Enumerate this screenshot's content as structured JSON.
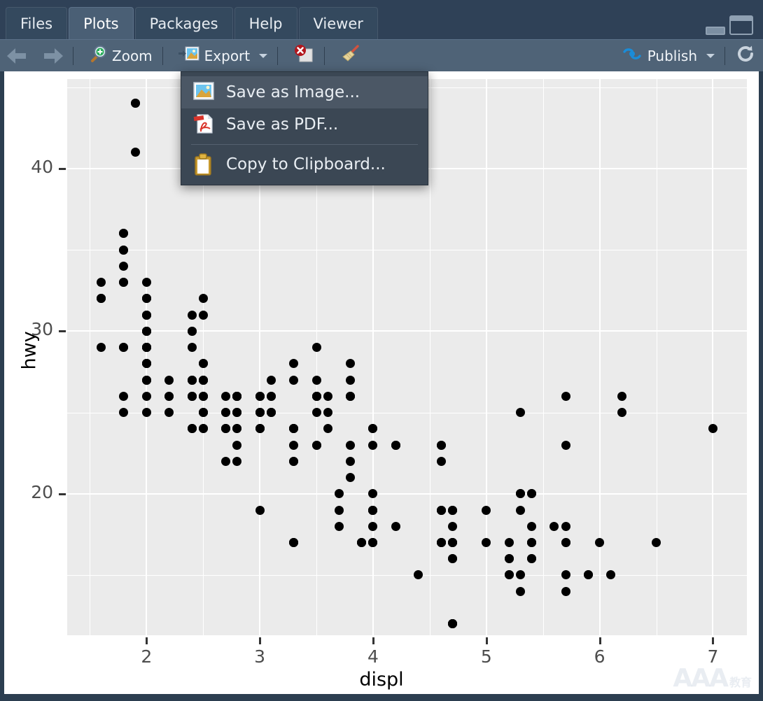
{
  "window": {
    "tabs": [
      {
        "label": "Files",
        "active": false
      },
      {
        "label": "Plots",
        "active": true
      },
      {
        "label": "Packages",
        "active": false
      },
      {
        "label": "Help",
        "active": false
      },
      {
        "label": "Viewer",
        "active": false
      }
    ],
    "controls": [
      {
        "name": "minimize-button",
        "label": "Minimize"
      },
      {
        "name": "maximize-button",
        "label": "Maximize"
      }
    ]
  },
  "toolbar": {
    "back_label": "Back",
    "forward_label": "Forward",
    "zoom_label": "Zoom",
    "export_label": "Export",
    "remove_plot_label": "Remove current plot",
    "clear_all_label": "Clear all plots",
    "publish_label": "Publish",
    "refresh_label": "Refresh current plot"
  },
  "export_menu": {
    "open": true,
    "items": [
      {
        "label": "Save as Image...",
        "icon": "image-icon",
        "selected": true
      },
      {
        "label": "Save as PDF...",
        "icon": "pdf-icon",
        "selected": false
      },
      {
        "label": "Copy to Clipboard...",
        "icon": "clipboard-icon",
        "selected": false
      }
    ]
  },
  "watermark": {
    "text": "AAA",
    "sub": "教育"
  },
  "colors": {
    "tabbar_bg": "#2f4157",
    "tab_active_bg": "#4a5f75",
    "toolbar_bg": "#4f6377",
    "menu_bg": "#3b4754",
    "menu_selected_bg": "#4b5765",
    "panel_bg": "#ebebeb",
    "gridline": "#ffffff",
    "point": "#000000",
    "publish_blue": "#1a8cd8",
    "plot_bg": "#ffffff"
  },
  "chart_data": {
    "type": "scatter",
    "title": "",
    "xlabel": "displ",
    "ylabel": "hwy",
    "xlim": [
      1.3,
      7.3
    ],
    "ylim": [
      11.3,
      45.5
    ],
    "xticks": [
      2,
      3,
      4,
      5,
      6,
      7
    ],
    "yticks": [
      20,
      30,
      40
    ],
    "x_minor_ticks": [
      1.5,
      2.5,
      3.5,
      4.5,
      5.5,
      6.5
    ],
    "y_minor_ticks": [
      15,
      25,
      35,
      45
    ],
    "grid": true,
    "legend": "none",
    "point_color": "#000000",
    "point_size": 13,
    "panel_background": "#ebebeb",
    "n_points": 234,
    "points": [
      [
        1.8,
        29
      ],
      [
        1.8,
        29
      ],
      [
        2.0,
        31
      ],
      [
        2.0,
        30
      ],
      [
        2.8,
        26
      ],
      [
        2.8,
        26
      ],
      [
        3.1,
        27
      ],
      [
        1.8,
        26
      ],
      [
        1.8,
        25
      ],
      [
        2.0,
        28
      ],
      [
        2.0,
        27
      ],
      [
        2.8,
        25
      ],
      [
        2.8,
        25
      ],
      [
        3.1,
        25
      ],
      [
        3.1,
        25
      ],
      [
        2.8,
        24
      ],
      [
        3.1,
        25
      ],
      [
        4.2,
        23
      ],
      [
        5.3,
        20
      ],
      [
        5.3,
        15
      ],
      [
        5.3,
        20
      ],
      [
        5.7,
        17
      ],
      [
        6.0,
        17
      ],
      [
        5.7,
        26
      ],
      [
        5.7,
        23
      ],
      [
        6.2,
        26
      ],
      [
        6.2,
        25
      ],
      [
        7.0,
        24
      ],
      [
        5.3,
        19
      ],
      [
        5.3,
        14
      ],
      [
        5.7,
        15
      ],
      [
        6.5,
        17
      ],
      [
        2.4,
        27
      ],
      [
        2.4,
        30
      ],
      [
        3.1,
        26
      ],
      [
        3.5,
        29
      ],
      [
        3.6,
        26
      ],
      [
        2.4,
        24
      ],
      [
        3.0,
        24
      ],
      [
        3.3,
        22
      ],
      [
        3.3,
        22
      ],
      [
        3.3,
        24
      ],
      [
        3.3,
        24
      ],
      [
        3.3,
        17
      ],
      [
        3.8,
        22
      ],
      [
        3.8,
        21
      ],
      [
        3.8,
        23
      ],
      [
        4.0,
        23
      ],
      [
        3.7,
        19
      ],
      [
        3.7,
        18
      ],
      [
        3.9,
        17
      ],
      [
        3.9,
        17
      ],
      [
        4.7,
        19
      ],
      [
        4.7,
        19
      ],
      [
        4.7,
        12
      ],
      [
        5.2,
        17
      ],
      [
        5.2,
        15
      ],
      [
        3.9,
        17
      ],
      [
        4.7,
        17
      ],
      [
        4.7,
        12
      ],
      [
        4.7,
        17
      ],
      [
        5.2,
        16
      ],
      [
        5.7,
        18
      ],
      [
        5.9,
        15
      ],
      [
        4.7,
        16
      ],
      [
        4.7,
        12
      ],
      [
        4.7,
        17
      ],
      [
        4.7,
        17
      ],
      [
        4.7,
        16
      ],
      [
        4.7,
        12
      ],
      [
        5.2,
        15
      ],
      [
        5.2,
        16
      ],
      [
        5.7,
        17
      ],
      [
        5.9,
        15
      ],
      [
        4.6,
        17
      ],
      [
        5.4,
        17
      ],
      [
        5.4,
        16
      ],
      [
        4.0,
        19
      ],
      [
        4.0,
        19
      ],
      [
        4.0,
        17
      ],
      [
        4.0,
        17
      ],
      [
        4.6,
        17
      ],
      [
        5.0,
        17
      ],
      [
        4.2,
        23
      ],
      [
        4.2,
        23
      ],
      [
        4.6,
        19
      ],
      [
        4.6,
        19
      ],
      [
        4.6,
        19
      ],
      [
        5.4,
        17
      ],
      [
        5.4,
        20
      ],
      [
        3.8,
        26
      ],
      [
        3.8,
        26
      ],
      [
        4.0,
        24
      ],
      [
        4.0,
        24
      ],
      [
        4.6,
        23
      ],
      [
        4.6,
        22
      ],
      [
        4.6,
        23
      ],
      [
        5.4,
        20
      ],
      [
        1.6,
        33
      ],
      [
        1.6,
        32
      ],
      [
        1.6,
        32
      ],
      [
        1.6,
        29
      ],
      [
        1.6,
        32
      ],
      [
        1.8,
        34
      ],
      [
        1.8,
        36
      ],
      [
        1.8,
        36
      ],
      [
        2.0,
        29
      ],
      [
        2.4,
        26
      ],
      [
        2.4,
        27
      ],
      [
        2.4,
        30
      ],
      [
        2.4,
        31
      ],
      [
        2.5,
        26
      ],
      [
        2.5,
        26
      ],
      [
        3.3,
        28
      ],
      [
        2.0,
        26
      ],
      [
        2.0,
        29
      ],
      [
        2.0,
        28
      ],
      [
        2.0,
        27
      ],
      [
        2.7,
        24
      ],
      [
        2.7,
        24
      ],
      [
        2.7,
        22
      ],
      [
        3.0,
        19
      ],
      [
        3.7,
        20
      ],
      [
        4.0,
        17
      ],
      [
        4.7,
        12
      ],
      [
        4.7,
        19
      ],
      [
        4.7,
        18
      ],
      [
        5.7,
        14
      ],
      [
        6.1,
        15
      ],
      [
        4.0,
        18
      ],
      [
        4.2,
        18
      ],
      [
        4.4,
        15
      ],
      [
        4.6,
        17
      ],
      [
        5.4,
        16
      ],
      [
        5.4,
        18
      ],
      [
        5.4,
        17
      ],
      [
        4.0,
        19
      ],
      [
        4.0,
        19
      ],
      [
        4.6,
        17
      ],
      [
        5.0,
        19
      ],
      [
        2.4,
        29
      ],
      [
        2.4,
        27
      ],
      [
        2.5,
        31
      ],
      [
        2.5,
        32
      ],
      [
        3.5,
        27
      ],
      [
        3.5,
        26
      ],
      [
        3.0,
        26
      ],
      [
        3.0,
        25
      ],
      [
        3.5,
        25
      ],
      [
        3.3,
        17
      ],
      [
        3.3,
        17
      ],
      [
        4.0,
        20
      ],
      [
        5.6,
        18
      ],
      [
        3.1,
        26
      ],
      [
        3.8,
        26
      ],
      [
        3.8,
        27
      ],
      [
        3.8,
        28
      ],
      [
        5.3,
        25
      ],
      [
        2.5,
        25
      ],
      [
        2.5,
        24
      ],
      [
        2.5,
        27
      ],
      [
        2.5,
        25
      ],
      [
        3.5,
        26
      ],
      [
        3.5,
        23
      ],
      [
        3.0,
        26
      ],
      [
        3.5,
        26
      ],
      [
        3.5,
        26
      ],
      [
        3.5,
        26
      ],
      [
        3.0,
        25
      ],
      [
        3.3,
        27
      ],
      [
        2.0,
        25
      ],
      [
        2.0,
        27
      ],
      [
        2.0,
        29
      ],
      [
        2.0,
        29
      ],
      [
        2.5,
        24
      ],
      [
        2.5,
        25
      ],
      [
        2.8,
        25
      ],
      [
        2.8,
        24
      ],
      [
        2.8,
        22
      ],
      [
        2.8,
        23
      ],
      [
        3.6,
        24
      ],
      [
        3.6,
        25
      ],
      [
        2.2,
        26
      ],
      [
        2.2,
        25
      ],
      [
        2.4,
        24
      ],
      [
        2.4,
        24
      ],
      [
        3.0,
        24
      ],
      [
        3.0,
        24
      ],
      [
        3.5,
        23
      ],
      [
        2.2,
        26
      ],
      [
        2.2,
        27
      ],
      [
        2.4,
        26
      ],
      [
        2.4,
        26
      ],
      [
        3.0,
        25
      ],
      [
        3.0,
        26
      ],
      [
        3.3,
        24
      ],
      [
        1.8,
        33
      ],
      [
        1.8,
        33
      ],
      [
        2.0,
        32
      ],
      [
        2.0,
        32
      ],
      [
        2.7,
        26
      ],
      [
        2.7,
        25
      ],
      [
        3.3,
        24
      ],
      [
        1.8,
        35
      ],
      [
        1.8,
        35
      ],
      [
        2.0,
        32
      ],
      [
        2.0,
        33
      ],
      [
        2.7,
        24
      ],
      [
        2.7,
        25
      ],
      [
        3.3,
        23
      ],
      [
        2.0,
        28
      ],
      [
        2.0,
        29
      ],
      [
        2.0,
        30
      ],
      [
        2.0,
        31
      ],
      [
        2.0,
        30
      ],
      [
        2.0,
        29
      ],
      [
        2.5,
        28
      ],
      [
        2.5,
        28
      ],
      [
        2.8,
        26
      ],
      [
        2.8,
        26
      ],
      [
        1.9,
        44
      ],
      [
        2.0,
        30
      ],
      [
        2.0,
        29
      ],
      [
        2.0,
        28
      ],
      [
        2.0,
        29
      ],
      [
        2.5,
        27
      ],
      [
        2.5,
        27
      ],
      [
        1.9,
        41
      ],
      [
        2.0,
        31
      ],
      [
        2.0,
        30
      ],
      [
        2.0,
        29
      ],
      [
        2.8,
        26
      ],
      [
        2.8,
        26
      ],
      [
        1.9,
        44
      ],
      [
        2.0,
        28
      ],
      [
        2.0,
        29
      ],
      [
        2.5,
        27
      ],
      [
        2.5,
        26
      ],
      [
        2.8,
        26
      ],
      [
        2.8,
        26
      ]
    ]
  }
}
